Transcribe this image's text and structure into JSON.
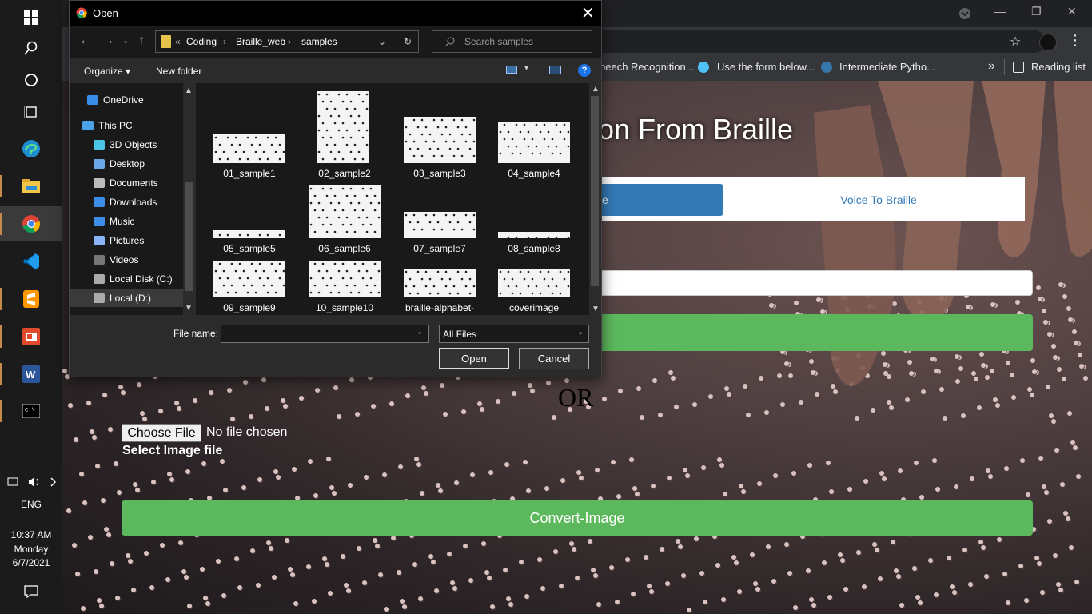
{
  "taskbar": {
    "language": "ENG",
    "time": "10:37 AM",
    "day": "Monday",
    "date": "6/7/2021",
    "tray_chevron": ">"
  },
  "browser": {
    "bookmarks": [
      "peech Recognition...",
      "Use the form below...",
      "Intermediate Pytho..."
    ],
    "bookmarks_more": "»",
    "reading_list": "Reading list"
  },
  "page": {
    "title": "ion From Braille",
    "tab_braille_to_voice": "ce",
    "tab_voice_to_braille": "Voice To Braille",
    "or_text": "OR",
    "choose_file_label": "Choose File",
    "no_file_text": "No file chosen",
    "select_image_label": "Select Image file",
    "convert_button": "Convert-Image"
  },
  "dialog": {
    "title": "Open",
    "close_glyph": "✕",
    "breadcrumb": [
      "Coding",
      "Braille_web",
      "samples"
    ],
    "breadcrumb_prefix": "«",
    "search_placeholder": "Search samples",
    "organize": "Organize ▾",
    "new_folder": "New folder",
    "help": "?",
    "nav_items": [
      {
        "label": "OneDrive"
      },
      {
        "label": "This PC"
      },
      {
        "label": "3D Objects"
      },
      {
        "label": "Desktop"
      },
      {
        "label": "Documents"
      },
      {
        "label": "Downloads"
      },
      {
        "label": "Music"
      },
      {
        "label": "Pictures"
      },
      {
        "label": "Videos"
      },
      {
        "label": "Local Disk (C:)"
      },
      {
        "label": "Local (D:)"
      }
    ],
    "files": [
      {
        "name": "01_sample1"
      },
      {
        "name": "02_sample2"
      },
      {
        "name": "03_sample3"
      },
      {
        "name": "04_sample4"
      },
      {
        "name": "05_sample5"
      },
      {
        "name": "06_sample6"
      },
      {
        "name": "07_sample7"
      },
      {
        "name": "08_sample8"
      },
      {
        "name": "09_sample9"
      },
      {
        "name": "10_sample10"
      },
      {
        "name": "braille-alphabet-"
      },
      {
        "name": "coverimage"
      }
    ],
    "file_name_label": "File name:",
    "file_name_value": "",
    "filter": "All Files",
    "open_button": "Open",
    "cancel_button": "Cancel"
  }
}
